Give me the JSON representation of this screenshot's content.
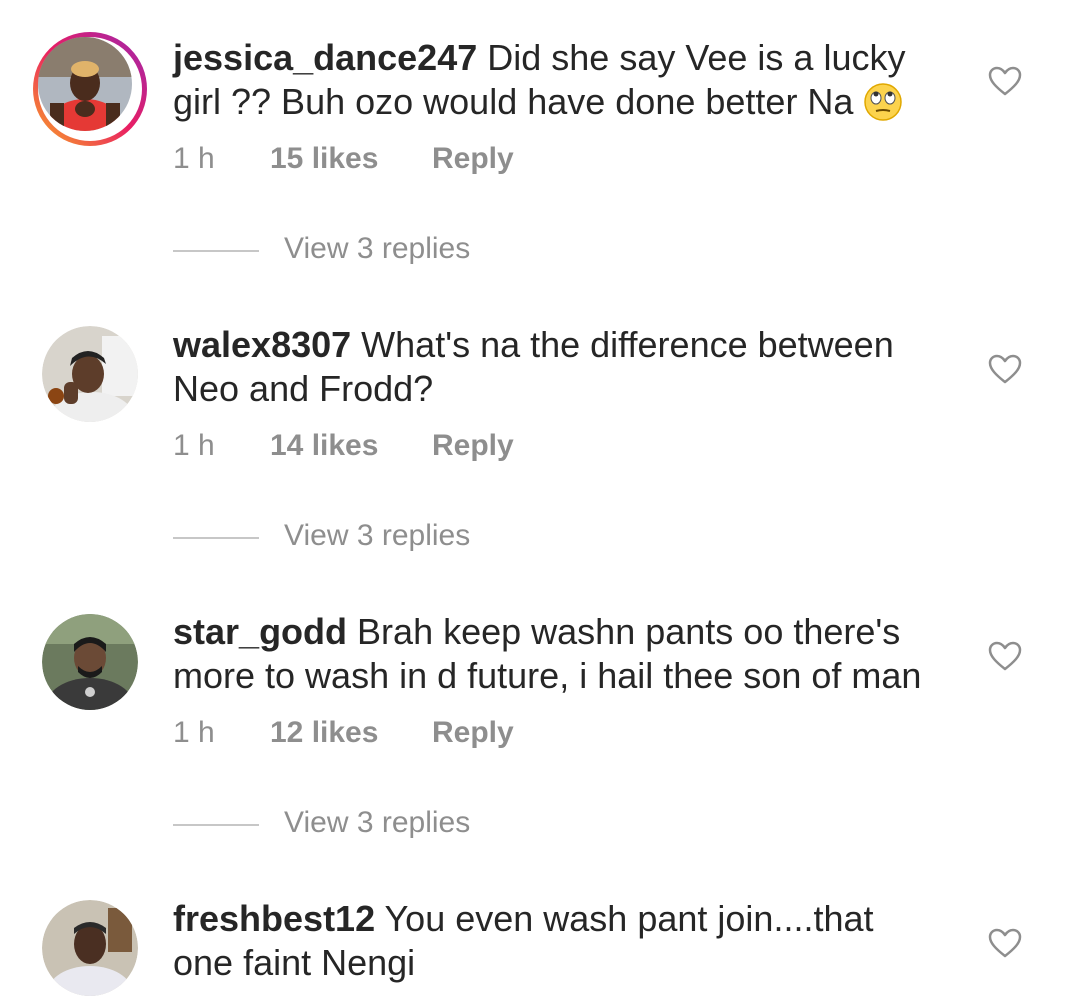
{
  "comments": [
    {
      "username": "jessica_dance247",
      "text": "Did she say Vee is a lucky girl ?? Buh ozo would have done better Na",
      "emoji": "eye-roll-emoji",
      "time": "1 h",
      "likes": "15 likes",
      "reply": "Reply",
      "view_replies": "View 3 replies",
      "has_story": true,
      "avatar_colors": {
        "bg": "#b0b7c0",
        "skin": "#4a2c1d",
        "shirt": "#e53935",
        "hair": "#e0b36a"
      }
    },
    {
      "username": "walex8307",
      "text": "What's na the difference between Neo and Frodd?",
      "time": "1 h",
      "likes": "14 likes",
      "reply": "Reply",
      "view_replies": "View 3 replies",
      "has_story": false,
      "avatar_colors": {
        "bg": "#d8d4cc",
        "skin": "#5d3d2a",
        "shirt": "#eeeeee",
        "hair": "#222222"
      }
    },
    {
      "username": "star_godd",
      "text": "Brah keep washn pants oo there's more to wash in d future, i hail thee son of man",
      "time": "1 h",
      "likes": "12 likes",
      "reply": "Reply",
      "view_replies": "View 3 replies",
      "has_story": false,
      "avatar_colors": {
        "bg": "#6b7a5e",
        "skin": "#6b4a36",
        "shirt": "#3a3a3a",
        "hair": "#1a1a1a"
      }
    },
    {
      "username": "freshbest12",
      "text": "You even wash pant join....that one faint Nengi",
      "has_story": false,
      "avatar_colors": {
        "bg": "#c9c2b4",
        "skin": "#4a2f22",
        "shirt": "#e9e9f0",
        "hair": "#2a2a2a"
      }
    }
  ]
}
